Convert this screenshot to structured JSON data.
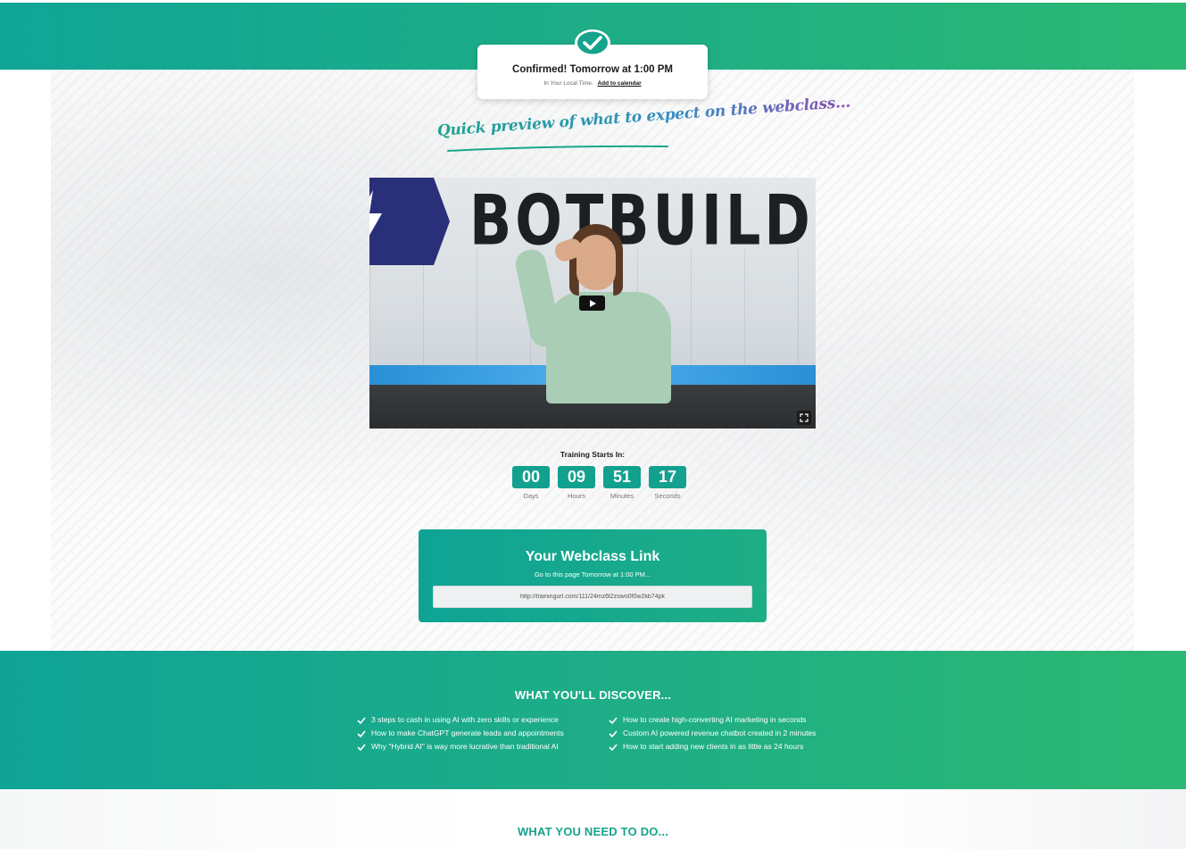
{
  "confirmation": {
    "icon": "check-circle-icon",
    "title": "Confirmed! Tomorrow at 1:00 PM",
    "subtitle": "In Your Local Time.",
    "calendar_link": "Add to calendar"
  },
  "preview": {
    "heading": "Quick preview of what to expect on the webclass..."
  },
  "video": {
    "brand_text": "BOTBUILDERS",
    "play_icon": "play-icon",
    "fullscreen_icon": "fullscreen-icon"
  },
  "countdown": {
    "label": "Training Starts In:",
    "units": [
      {
        "value": "00",
        "caption": "Days"
      },
      {
        "value": "09",
        "caption": "Hours"
      },
      {
        "value": "51",
        "caption": "Minutes"
      },
      {
        "value": "17",
        "caption": "Seconds"
      }
    ]
  },
  "webclass_link": {
    "title": "Your Webclass Link",
    "subtitle": "Go to this page Tomorrow at 1:00 PM...",
    "url": "http://trainingurl.com/111/24mz6t2zswo0f0w2kb74pk"
  },
  "discover": {
    "title": "WHAT YOU'LL DISCOVER...",
    "left_items": [
      "3 steps to cash in using AI with zero skills or experience",
      "How to make ChatGPT generate leads and appointments",
      "Why \"Hybrid AI\" is way more lucrative than traditional AI"
    ],
    "right_items": [
      "How to create high-converting AI marketing in seconds",
      "Custom AI powered revenue chatbot created in 2 minutes",
      "How to start adding new clients in as little as 24 hours"
    ]
  },
  "need": {
    "title": "WHAT YOU NEED TO DO..."
  },
  "colors": {
    "brand_green": "#12a18e",
    "gradient_end": "#2bb873",
    "heading_purple": "#8b4db0"
  }
}
